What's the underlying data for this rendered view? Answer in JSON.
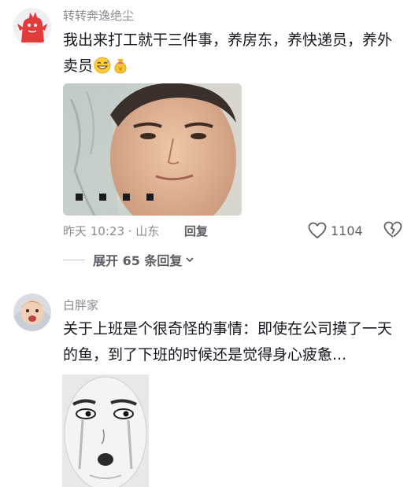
{
  "comments": [
    {
      "username": "转转奔逸绝尘",
      "text": "我出来打工就干三件事，养房东，养快递员，养外卖员",
      "emojis": [
        "grinning-sweat-emoji",
        "money-bag-emoji"
      ],
      "time_location": "昨天 10:23 · 山东",
      "reply_label": "回复",
      "likes": "1104",
      "expand_label": "展开 65 条回复"
    },
    {
      "username": "白胖家",
      "text": "关于上班是个很奇怪的事情：即使在公司摸了一天的鱼，到了下班的时候还是觉得身心疲惫..."
    }
  ],
  "colors": {
    "username": "#8a8b91",
    "text": "#161823",
    "secondary": "#5e5f66"
  }
}
